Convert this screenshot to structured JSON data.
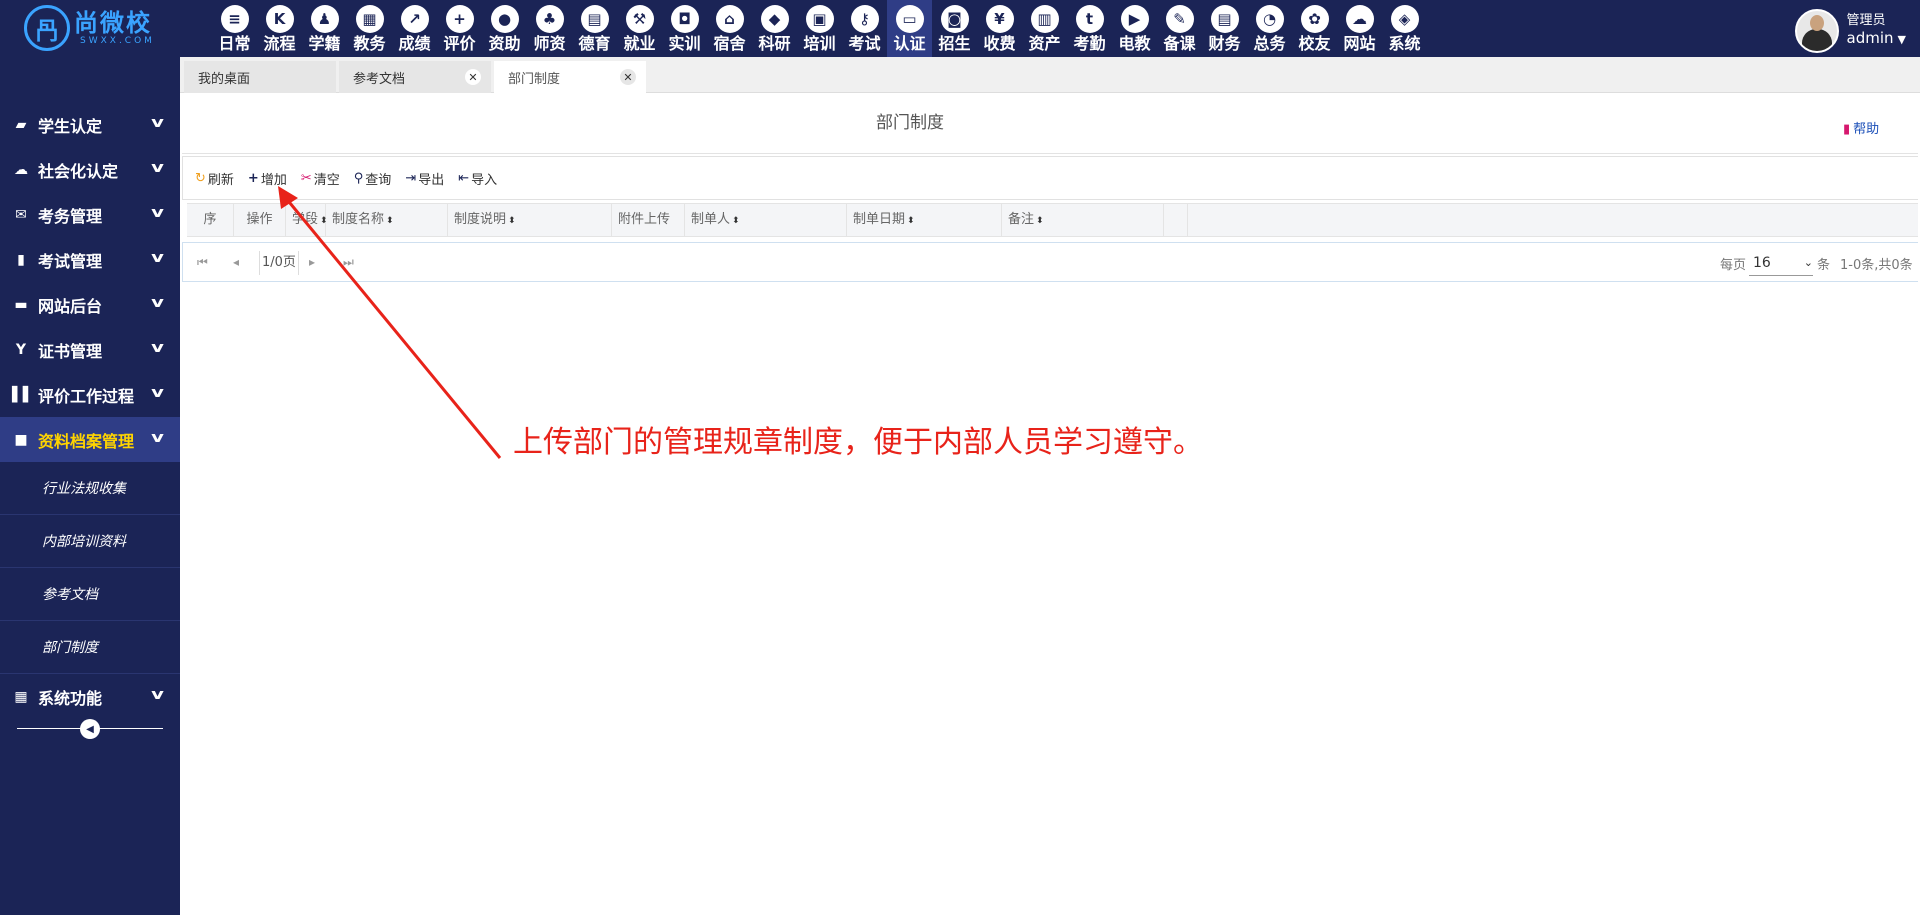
{
  "app": {
    "logo_name": "尚微校",
    "logo_sub": "SWXX.COM",
    "logo_mark": "冎"
  },
  "modules": [
    {
      "label": "日常",
      "icon": "document-icon",
      "glyph": "≡"
    },
    {
      "label": "流程",
      "icon": "flow-icon",
      "glyph": "K"
    },
    {
      "label": "学籍",
      "icon": "person-icon",
      "glyph": "♟"
    },
    {
      "label": "教务",
      "icon": "calendar-icon",
      "glyph": "▦"
    },
    {
      "label": "成绩",
      "icon": "trend-icon",
      "glyph": "↗"
    },
    {
      "label": "评价",
      "icon": "calendar-plus-icon",
      "glyph": "+"
    },
    {
      "label": "资助",
      "icon": "user-icon",
      "glyph": "●"
    },
    {
      "label": "师资",
      "icon": "teacher-icon",
      "glyph": "♣"
    },
    {
      "label": "德育",
      "icon": "book-icon",
      "glyph": "▤"
    },
    {
      "label": "就业",
      "icon": "hammer-icon",
      "glyph": "⚒"
    },
    {
      "label": "实训",
      "icon": "gamepad-icon",
      "glyph": "◘"
    },
    {
      "label": "宿舍",
      "icon": "home-icon",
      "glyph": "⌂"
    },
    {
      "label": "科研",
      "icon": "graduation-cap-icon",
      "glyph": "◆"
    },
    {
      "label": "培训",
      "icon": "image-icon",
      "glyph": "▣"
    },
    {
      "label": "考试",
      "icon": "key-icon",
      "glyph": "⚷"
    },
    {
      "label": "认证",
      "icon": "monitor-icon",
      "glyph": "▭"
    },
    {
      "label": "招生",
      "icon": "bus-icon",
      "glyph": "◙"
    },
    {
      "label": "收费",
      "icon": "yen-icon",
      "glyph": "¥"
    },
    {
      "label": "资产",
      "icon": "train-icon",
      "glyph": "▥"
    },
    {
      "label": "考勤",
      "icon": "tumblr-icon",
      "glyph": "t"
    },
    {
      "label": "电教",
      "icon": "video-file-icon",
      "glyph": "▶"
    },
    {
      "label": "备课",
      "icon": "edit-icon",
      "glyph": "✎"
    },
    {
      "label": "财务",
      "icon": "newspaper-icon",
      "glyph": "▤"
    },
    {
      "label": "总务",
      "icon": "dashboard-icon",
      "glyph": "◔"
    },
    {
      "label": "校友",
      "icon": "group-icon",
      "glyph": "✿"
    },
    {
      "label": "网站",
      "icon": "cloud-icon",
      "glyph": "☁"
    },
    {
      "label": "系统",
      "icon": "cube-icon",
      "glyph": "◈"
    }
  ],
  "active_module": "认证",
  "user": {
    "role": "管理员",
    "name": "admin"
  },
  "sidebar": {
    "items": [
      {
        "label": "学生认定",
        "icon": "book-icon",
        "glyph": "▰"
      },
      {
        "label": "社会化认定",
        "icon": "cloud-icon",
        "glyph": "☁"
      },
      {
        "label": "考务管理",
        "icon": "envelope-icon",
        "glyph": "✉"
      },
      {
        "label": "考试管理",
        "icon": "file-icon",
        "glyph": "▮"
      },
      {
        "label": "网站后台",
        "icon": "folder-icon",
        "glyph": "▬"
      },
      {
        "label": "证书管理",
        "icon": "certificate-icon",
        "glyph": "Y"
      },
      {
        "label": "评价工作过程",
        "icon": "columns-icon",
        "glyph": "▌▌"
      },
      {
        "label": "资料档案管理",
        "icon": "square-icon",
        "glyph": "■"
      }
    ],
    "subitems": [
      "行业法规收集",
      "内部培训资料",
      "参考文档",
      "部门制度"
    ],
    "footer_item": {
      "label": "系统功能",
      "icon": "grid-icon",
      "glyph": "▦"
    }
  },
  "tabs": [
    {
      "label": "我的桌面",
      "closable": false
    },
    {
      "label": "参考文档",
      "closable": true
    },
    {
      "label": "部门制度",
      "closable": true
    }
  ],
  "page": {
    "title": "部门制度",
    "help": "帮助"
  },
  "toolbar": {
    "refresh": "刷新",
    "add": "增加",
    "clear": "清空",
    "query": "查询",
    "export": "导出",
    "import": "导入"
  },
  "grid": {
    "columns": [
      "序",
      "操作",
      "学段",
      "制度名称",
      "制度说明",
      "附件上传",
      "制单人",
      "制单日期",
      "备注"
    ]
  },
  "pager": {
    "page_info": "1/0页",
    "page_size_label": "每页",
    "page_size": "16",
    "unit": "条",
    "total": "1-0条,共0条"
  },
  "annotation": {
    "text": "上传部门的管理规章制度，便于内部人员学习遵守。",
    "color": "#e8231a"
  },
  "colors": {
    "nav_bg": "#1b2456",
    "active_bg": "#2f3d86",
    "active_text": "#ffd400"
  }
}
